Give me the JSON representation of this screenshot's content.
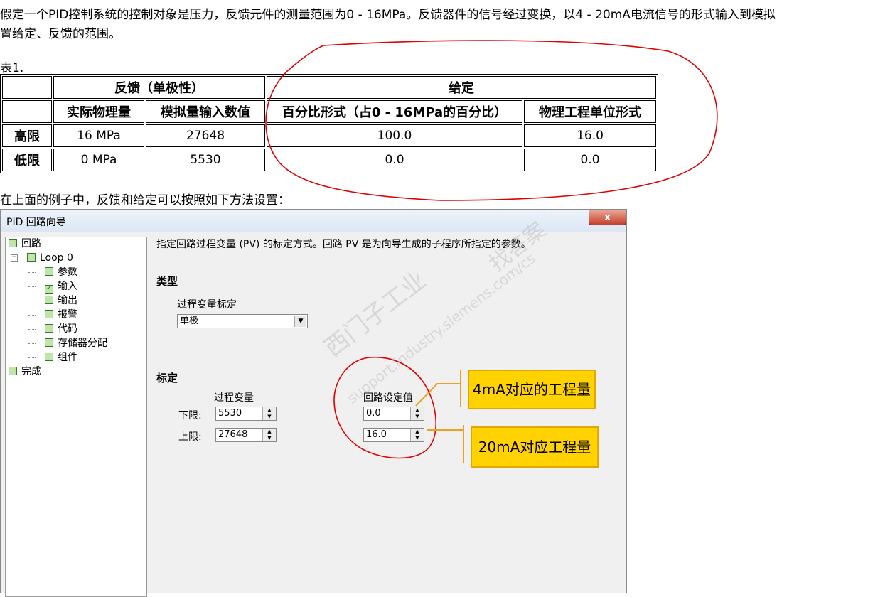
{
  "intro_line1": "假定一个PID控制系统的控制对象是压力，反馈元件的测量范围为0 - 16MPa。反馈器件的信号经过变换，以4 - 20mA电流信号的形式输入到模拟",
  "intro_line2": "置给定、反馈的范围。",
  "table_caption": "表1.",
  "table": {
    "group_feedback": "反馈（单极性）",
    "group_setpoint": "给定",
    "col_phys": "实际物理量",
    "col_analog": "模拟量输入数值",
    "col_percent": "百分比形式（占0 - 16MPa的百分比）",
    "col_eng": "物理工程单位形式",
    "rows": [
      {
        "label": "高限",
        "phys": "16 MPa",
        "analog": "27648",
        "percent": "100.0",
        "eng": "16.0"
      },
      {
        "label": "低限",
        "phys": "0 MPa",
        "analog": "5530",
        "percent": "0.0",
        "eng": "0.0"
      }
    ]
  },
  "below_text": "在上面的例子中，反馈和给定可以按照如下方法设置：",
  "wizard": {
    "title": "PID 回路向导",
    "close": "x",
    "tree": {
      "root": "回路",
      "loop": "Loop 0",
      "children": [
        "参数",
        "输入",
        "输出",
        "报警",
        "代码",
        "存储器分配",
        "组件"
      ],
      "finish": "完成"
    },
    "description": "指定回路过程变量 (PV) 的标定方式。回路 PV 是为向导生成的子程序所指定的参数。",
    "type_section": "类型",
    "pv_scaling_label": "过程变量标定",
    "pv_scaling_value": "单极",
    "scale_section": "标定",
    "pv_header": "过程变量",
    "sp_header": "回路设定值",
    "low_label": "下限:",
    "high_label": "上限:",
    "pv_low": "5530",
    "pv_high": "27648",
    "sp_low": "0.0",
    "sp_high": "16.0"
  },
  "callouts": {
    "c4ma": "4mA对应的工程量",
    "c20ma": "20mA对应工程量"
  },
  "watermark": {
    "line1": "西门子工业",
    "line2": "support.industry.siemens.com/cs",
    "line3": "找答案"
  },
  "colors": {
    "annotation_red": "#e00000",
    "callout_fill": "#ffd200",
    "callout_line": "#f0a020"
  }
}
